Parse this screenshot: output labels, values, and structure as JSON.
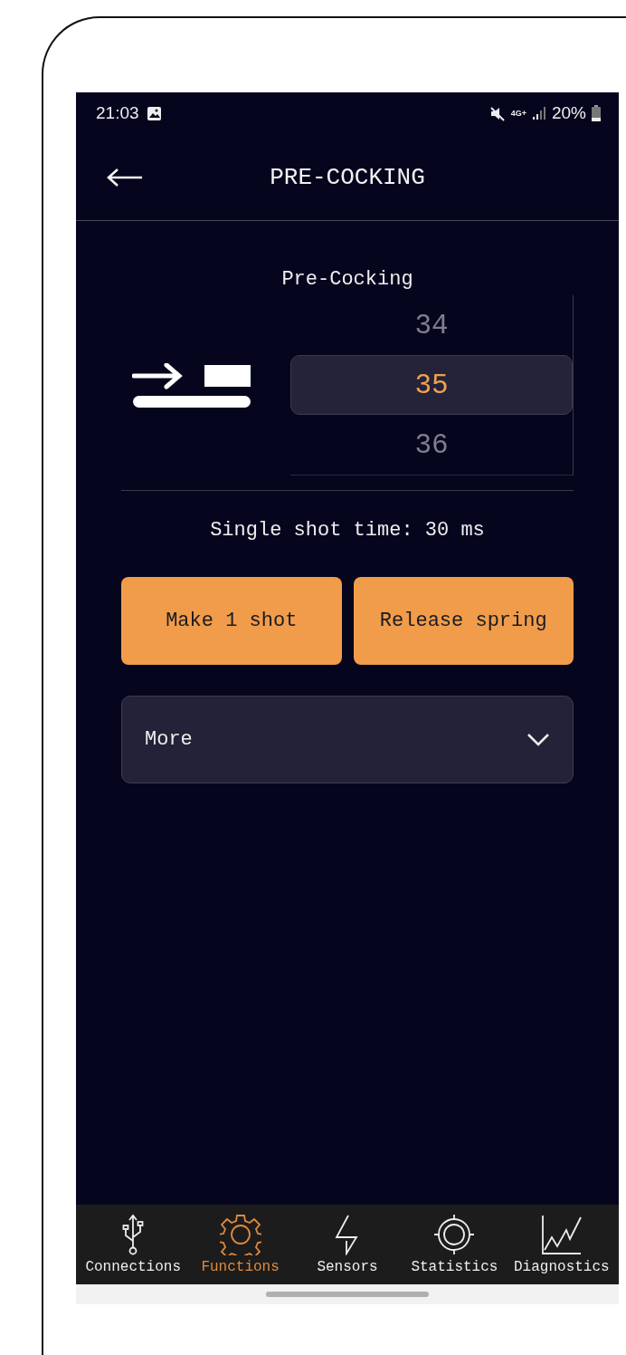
{
  "status_bar": {
    "time": "21:03",
    "network_type": "4G+",
    "battery": "20%"
  },
  "app_bar": {
    "title": "PRE-COCKING"
  },
  "picker": {
    "label": "Pre-Cocking",
    "values": [
      {
        "value": "34",
        "selected": false
      },
      {
        "value": "35",
        "selected": true
      },
      {
        "value": "36",
        "selected": false
      }
    ]
  },
  "info": "Single shot time: 30 ms",
  "buttons": [
    "Make 1 shot",
    "Release spring"
  ],
  "more": {
    "label": "More",
    "expanded": false
  },
  "bottom_nav": [
    {
      "label": "Connections",
      "selected": false
    },
    {
      "label": "Functions",
      "selected": true
    },
    {
      "label": "Sensors",
      "selected": false
    },
    {
      "label": "Statistics",
      "selected": false
    },
    {
      "label": "Diagnostics",
      "selected": false
    }
  ]
}
